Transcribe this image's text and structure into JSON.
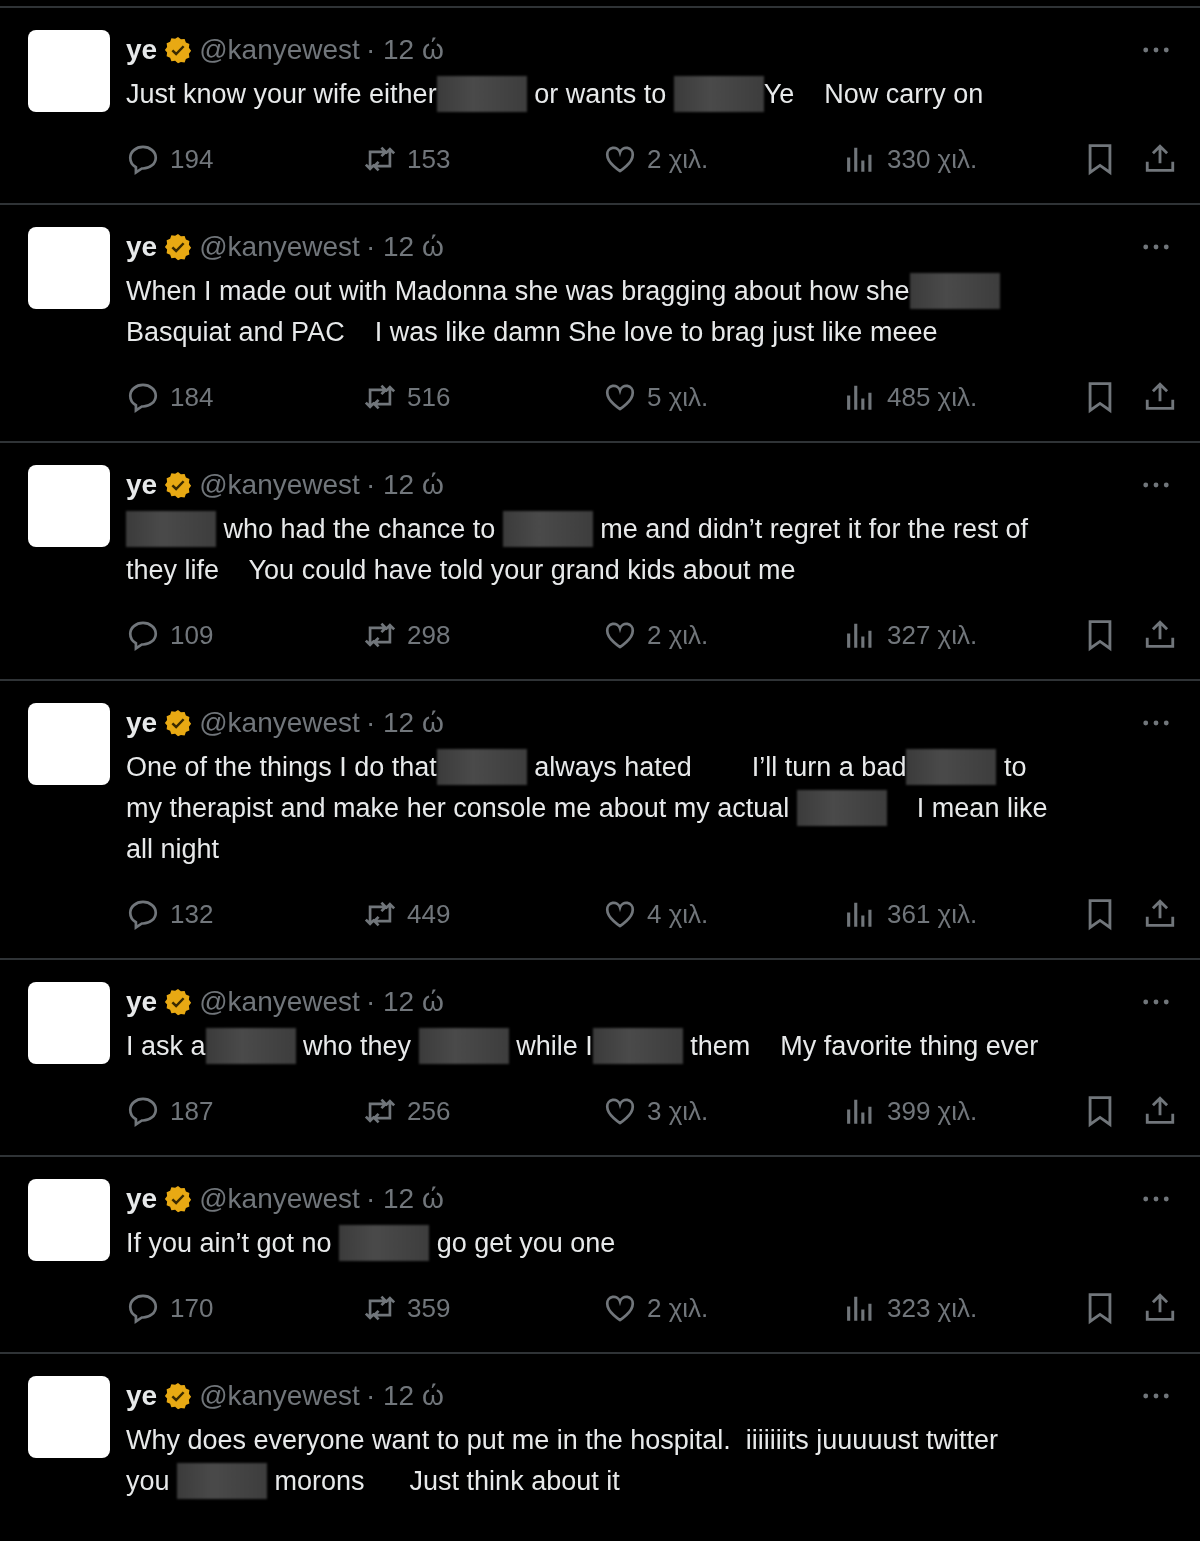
{
  "tweets": [
    {
      "name": "ye",
      "verified": true,
      "handle": "@kanyewest",
      "time": "· 12 ώ",
      "body": [
        [
          {
            "kind": "text",
            "text": "Just know your wife either"
          },
          {
            "kind": "redacted"
          },
          {
            "kind": "text",
            "text": " or wants to "
          },
          {
            "kind": "redacted"
          },
          {
            "kind": "text",
            "text": "Ye    Now carry on"
          }
        ]
      ],
      "replies": "194",
      "reposts": "153",
      "likes": "2 χιλ.",
      "views": "330 χιλ."
    },
    {
      "name": "ye",
      "verified": true,
      "handle": "@kanyewest",
      "time": "· 12 ώ",
      "body": [
        [
          {
            "kind": "text",
            "text": "When I made out with Madonna she was bragging about how she"
          },
          {
            "kind": "redacted"
          }
        ],
        [
          {
            "kind": "text",
            "text": "Basquiat and PAC    I was like damn She love to brag just like meee"
          }
        ]
      ],
      "replies": "184",
      "reposts": "516",
      "likes": "5 χιλ.",
      "views": "485 χιλ."
    },
    {
      "name": "ye",
      "verified": true,
      "handle": "@kanyewest",
      "time": "· 12 ώ",
      "body": [
        [
          {
            "kind": "redacted"
          },
          {
            "kind": "text",
            "text": " who had the chance to "
          },
          {
            "kind": "redacted"
          },
          {
            "kind": "text",
            "text": " me and didn’t regret it for the rest of"
          }
        ],
        [
          {
            "kind": "text",
            "text": "they life    You could have told your grand kids about me"
          }
        ]
      ],
      "replies": "109",
      "reposts": "298",
      "likes": "2 χιλ.",
      "views": "327 χιλ."
    },
    {
      "name": "ye",
      "verified": true,
      "handle": "@kanyewest",
      "time": "· 12 ώ",
      "body": [
        [
          {
            "kind": "text",
            "text": "One of the things I do that"
          },
          {
            "kind": "redacted"
          },
          {
            "kind": "text",
            "text": " always hated        I’ll turn a bad"
          },
          {
            "kind": "redacted"
          },
          {
            "kind": "text",
            "text": " to"
          }
        ],
        [
          {
            "kind": "text",
            "text": "my therapist and make her console me about my actual "
          },
          {
            "kind": "redacted"
          },
          {
            "kind": "text",
            "text": "    I mean like"
          }
        ],
        [
          {
            "kind": "text",
            "text": "all night"
          }
        ]
      ],
      "replies": "132",
      "reposts": "449",
      "likes": "4 χιλ.",
      "views": "361 χιλ."
    },
    {
      "name": "ye",
      "verified": true,
      "handle": "@kanyewest",
      "time": "· 12 ώ",
      "body": [
        [
          {
            "kind": "text",
            "text": "I ask a"
          },
          {
            "kind": "redacted"
          },
          {
            "kind": "text",
            "text": " who they "
          },
          {
            "kind": "redacted"
          },
          {
            "kind": "text",
            "text": " while I"
          },
          {
            "kind": "redacted"
          },
          {
            "kind": "text",
            "text": " them    My favorite thing ever"
          }
        ]
      ],
      "replies": "187",
      "reposts": "256",
      "likes": "3 χιλ.",
      "views": "399 χιλ."
    },
    {
      "name": "ye",
      "verified": true,
      "handle": "@kanyewest",
      "time": "· 12 ώ",
      "body": [
        [
          {
            "kind": "text",
            "text": "If you ain’t got no "
          },
          {
            "kind": "redacted"
          },
          {
            "kind": "text",
            "text": " go get you one"
          }
        ]
      ],
      "replies": "170",
      "reposts": "359",
      "likes": "2 χιλ.",
      "views": "323 χιλ."
    },
    {
      "name": "ye",
      "verified": true,
      "handle": "@kanyewest",
      "time": "· 12 ώ",
      "body": [
        [
          {
            "kind": "text",
            "text": "Why does everyone want to put me in the hospital.  iiiiiiits juuuuust twitter"
          }
        ],
        [
          {
            "kind": "text",
            "text": "you "
          },
          {
            "kind": "redacted"
          },
          {
            "kind": "text",
            "text": " morons      Just think about it"
          }
        ]
      ]
    }
  ]
}
